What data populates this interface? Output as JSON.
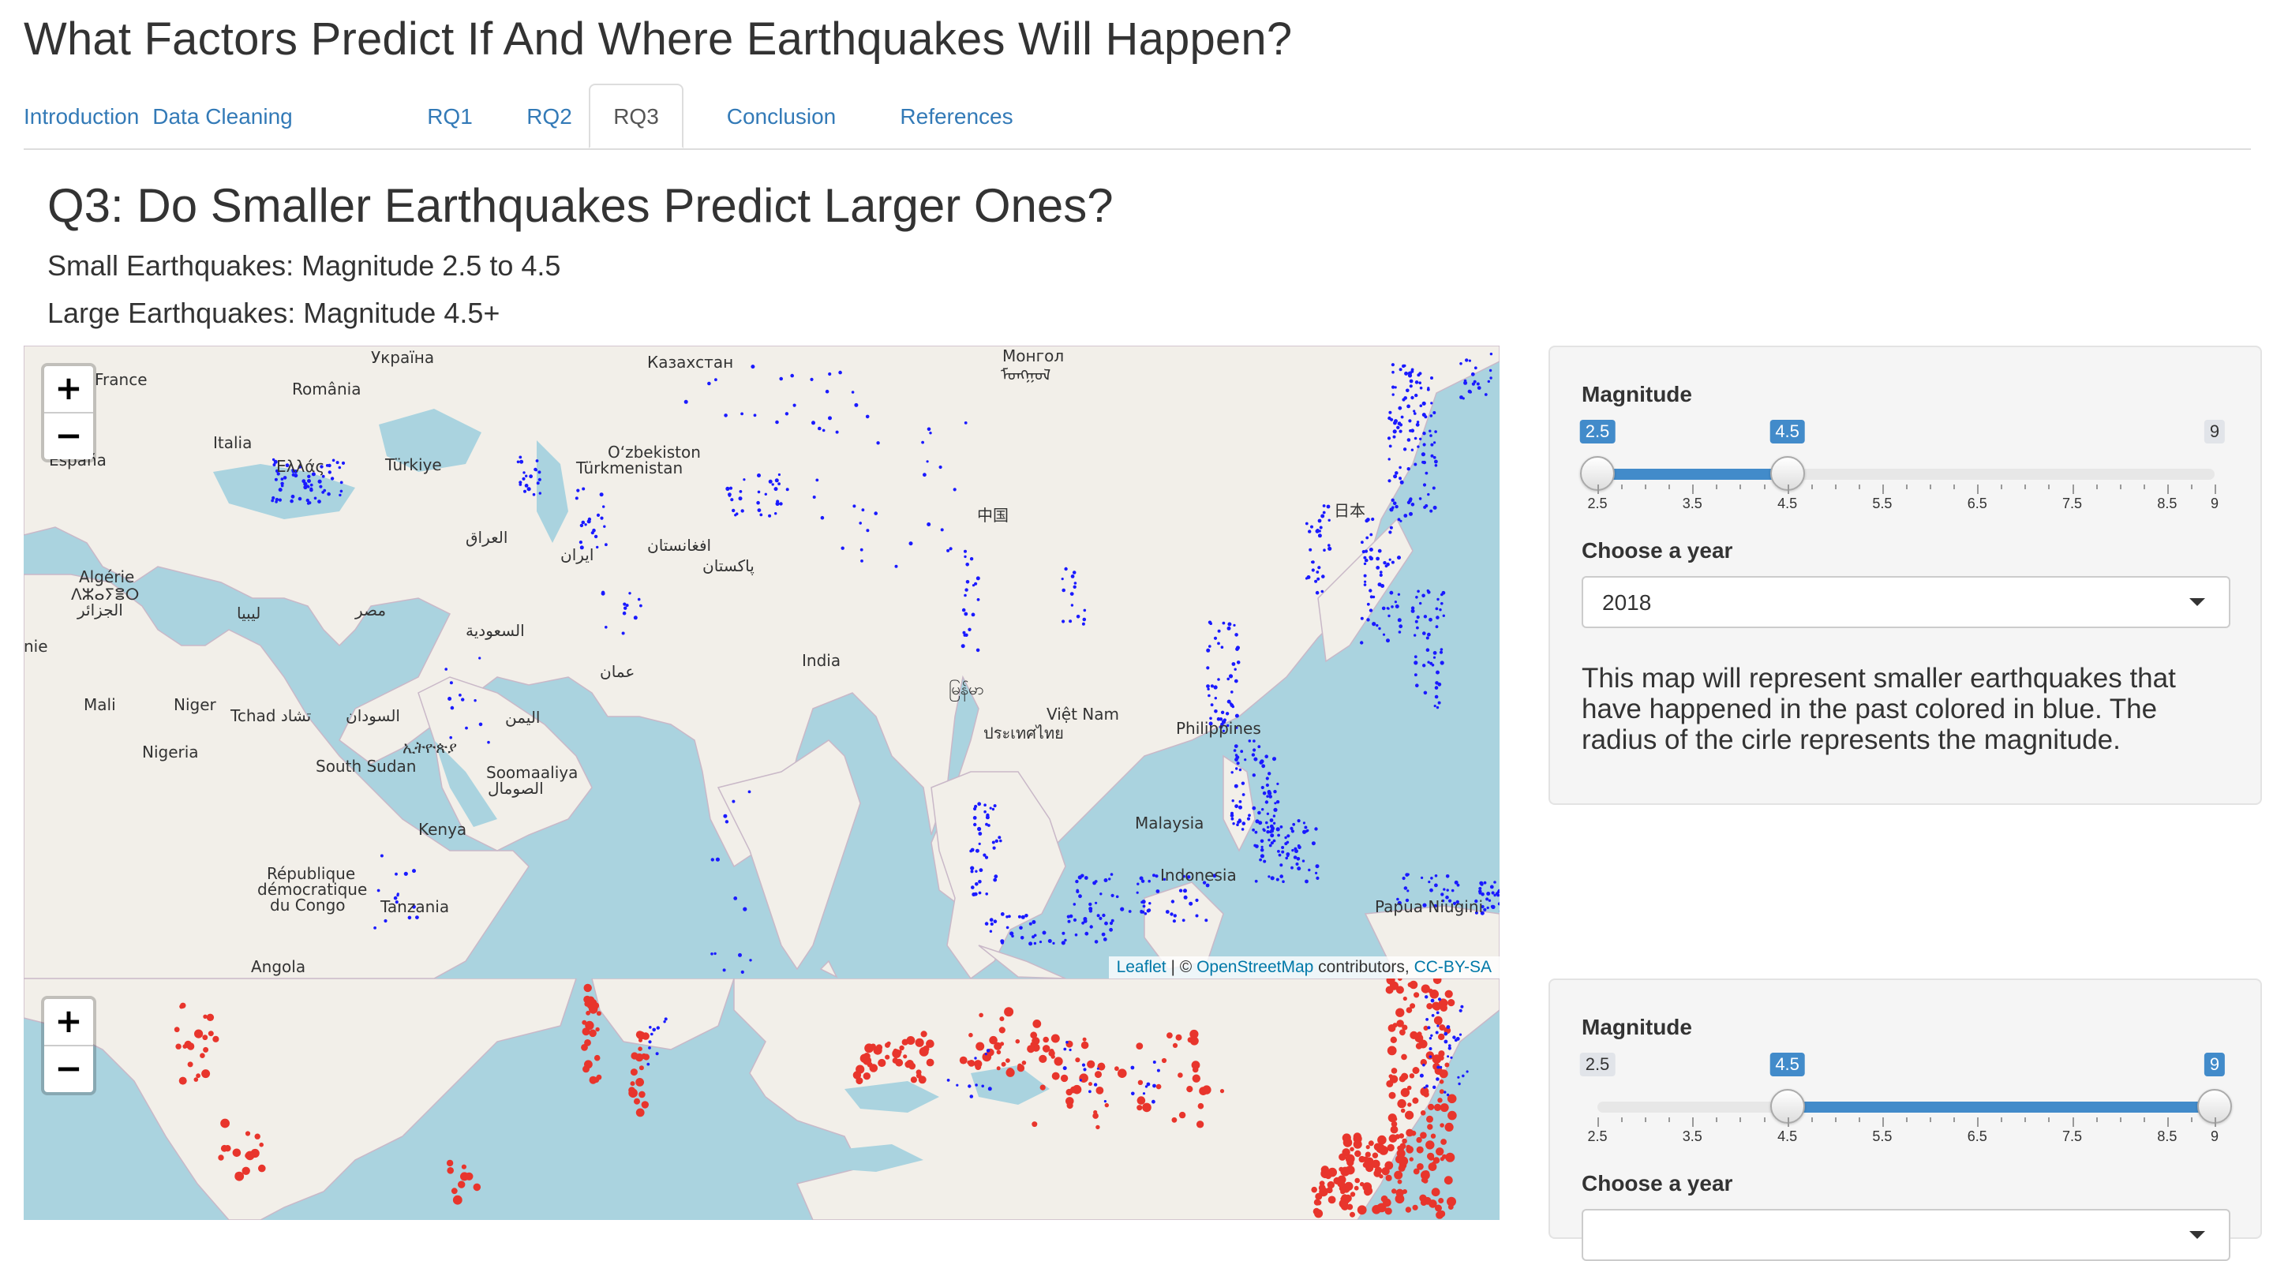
{
  "app": {
    "title": "What Factors Predict If And Where Earthquakes Will Happen?"
  },
  "tabs": [
    {
      "label": "Introduction"
    },
    {
      "label": "Data Cleaning"
    },
    {
      "label": "RQ1"
    },
    {
      "label": "RQ2"
    },
    {
      "label": "RQ3",
      "active": true
    },
    {
      "label": "Conclusion"
    },
    {
      "label": "References"
    }
  ],
  "page": {
    "heading": "Q3: Do Smaller Earthquakes Predict Larger Ones?",
    "small_def": "Small Earthquakes: Magnitude 2.5 to 4.5",
    "large_def": "Large Earthquakes: Magnitude 4.5+"
  },
  "map_controls": {
    "zoom_in": "+",
    "zoom_out": "−"
  },
  "attribution": {
    "leaflet": "Leaflet",
    "sep1": " | © ",
    "osm": "OpenStreetMap",
    "mid": " contributors, ",
    "license": "CC-BY-SA"
  },
  "map_labels": [
    "Україна",
    "France",
    "România",
    "Italia",
    "España",
    "Ελλάς",
    "Türkiye",
    "Казахстан",
    "O‘zbekiston",
    "Türkmenistan",
    "Монгол",
    "ᠮᠣᠩᠭᠣᠯ",
    "العراق",
    "ایران",
    "افغانستان",
    "پاکستان",
    "中国",
    "日本",
    "Algérie",
    "ⴷⵣⴰⵢⴻⵔ",
    "الجزائر",
    "ليبيا",
    "مصر",
    "السعودية",
    "عمان",
    "India",
    "Mali",
    "Niger",
    "Tchad تشاد",
    "السودان",
    "اليمن",
    "Việt Nam",
    "ประเทศไทย",
    "Philippines",
    "Nigeria",
    "South Sudan",
    "ኢትዮጵያ",
    "Soomaaliya",
    "الصومال",
    "Malaysia",
    "Kenya",
    "République",
    "démocratique",
    "du Congo",
    "Tanzania",
    "Indonesia",
    "Papua Niugini",
    "Angola",
    "nie",
    "မြန်မာ"
  ],
  "colors": {
    "small_quake": "#1a1aff",
    "large_quake": "#e8352c",
    "water": "#aad3df",
    "land": "#f2efe9",
    "slider_bar": "#428bca"
  },
  "small_panel": {
    "magnitude_label": "Magnitude",
    "slider": {
      "min": 2.5,
      "max": 9,
      "from": 2.5,
      "to": 4.5,
      "from_label": "2.5",
      "to_label": "4.5",
      "min_label": "2.5",
      "max_label": "9"
    },
    "tick_labels": [
      "2.5",
      "3.5",
      "4.5",
      "5.5",
      "6.5",
      "7.5",
      "8.5",
      "9"
    ],
    "year_label": "Choose a year",
    "year_value": "2018",
    "description": "This map will represent smaller earthquakes that have happened in the past colored in blue. The radius of the cirle represents the magnitude."
  },
  "large_panel": {
    "magnitude_label": "Magnitude",
    "slider": {
      "min": 2.5,
      "max": 9,
      "from": 4.5,
      "to": 9,
      "from_label": "4.5",
      "to_label": "9",
      "min_label": "2.5",
      "max_label": "9"
    },
    "tick_labels": [
      "2.5",
      "3.5",
      "4.5",
      "5.5",
      "6.5",
      "7.5",
      "8.5",
      "9"
    ],
    "year_label": "Choose a year"
  }
}
